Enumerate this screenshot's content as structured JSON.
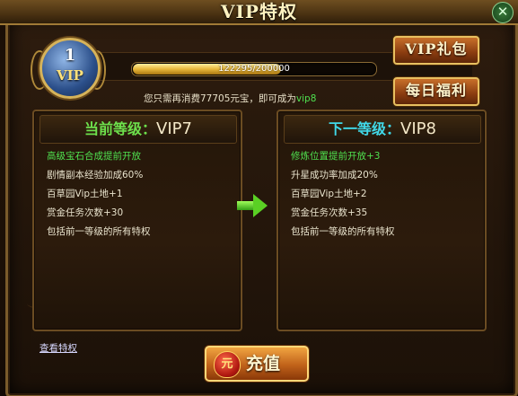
{
  "window": {
    "title": "VIP特权",
    "close_glyph": "✕"
  },
  "badge": {
    "level": "1",
    "label": "VIP"
  },
  "progress": {
    "current": 122295,
    "max": 200000,
    "text": "122295/200000",
    "fraction": 0.611
  },
  "need_message": {
    "prefix": "您只需再消费",
    "amount": "77705",
    "middle": "元宝，即可成为",
    "target": "vip8"
  },
  "buttons": {
    "vip_gift": "VIP礼包",
    "daily_welfare": "每日福利",
    "recharge": "充值",
    "recharge_icon": "元"
  },
  "current": {
    "header_label": "当前等级：",
    "level": "VIP7",
    "perks": [
      "高级宝石合成提前开放",
      "剧情副本经验加成60%",
      "百草园Vip土地+1",
      "赏金任务次数+30",
      "包括前一等级的所有特权"
    ]
  },
  "next": {
    "header_label": "下一等级：",
    "level": "VIP8",
    "perks": [
      "修炼位置提前开放+3",
      "升星成功率加成20%",
      "百草园Vip土地+2",
      "赏金任务次数+35",
      "包括前一等级的所有特权"
    ]
  },
  "link": {
    "view_privileges": "查看特权"
  },
  "colors": {
    "highlight_green": "#4fe04f",
    "gold_border": "#e8c060",
    "cyan": "#40d8e8"
  },
  "icons": {
    "badge": "vip-badge-icon",
    "arrow": "right-arrow-icon",
    "bag": "money-bag-icon",
    "close": "close-icon"
  }
}
